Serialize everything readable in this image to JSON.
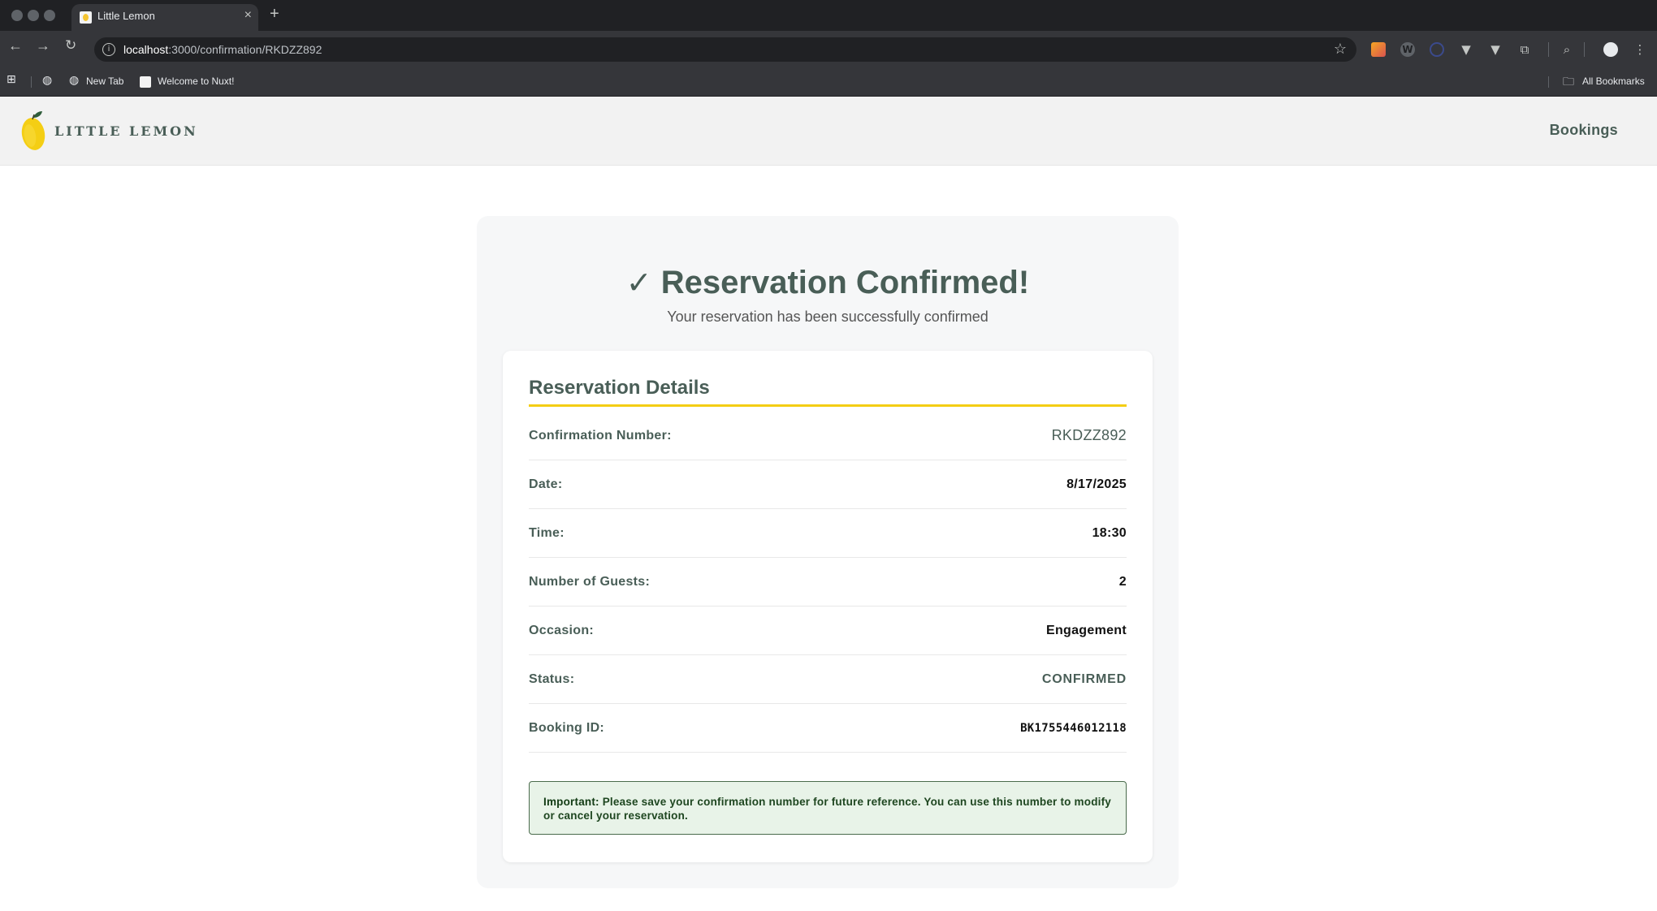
{
  "browser": {
    "tab_title": "Little Lemon",
    "url_host": "localhost",
    "url_rest": ":3000/confirmation/RKDZZ892",
    "bookmarks": [
      {
        "label": "New Tab"
      },
      {
        "label": "Welcome to Nuxt!"
      }
    ],
    "all_bookmarks_label": "All Bookmarks"
  },
  "site": {
    "logo_text": "LITTLE LEMON",
    "nav_bookings": "Bookings",
    "brand_colors": {
      "green": "#495e57",
      "yellow": "#f4ce14"
    }
  },
  "confirmation": {
    "check_icon": "✓",
    "heading": "Reservation Confirmed!",
    "subheading": "Your reservation has been successfully confirmed",
    "details_title": "Reservation Details",
    "rows": [
      {
        "label": "Confirmation Number:",
        "value": "RKDZZ892"
      },
      {
        "label": "Date:",
        "value": "8/17/2025"
      },
      {
        "label": "Time:",
        "value": "18:30"
      },
      {
        "label": "Number of Guests:",
        "value": "2"
      },
      {
        "label": "Occasion:",
        "value": "Engagement"
      },
      {
        "label": "Status:",
        "value": "CONFIRMED"
      },
      {
        "label": "Booking ID:",
        "value": "BK1755446012118"
      }
    ],
    "notice_strong": "Important:",
    "notice_text": "Please save your confirmation number for future reference. You can use this number to modify or cancel your reservation."
  }
}
